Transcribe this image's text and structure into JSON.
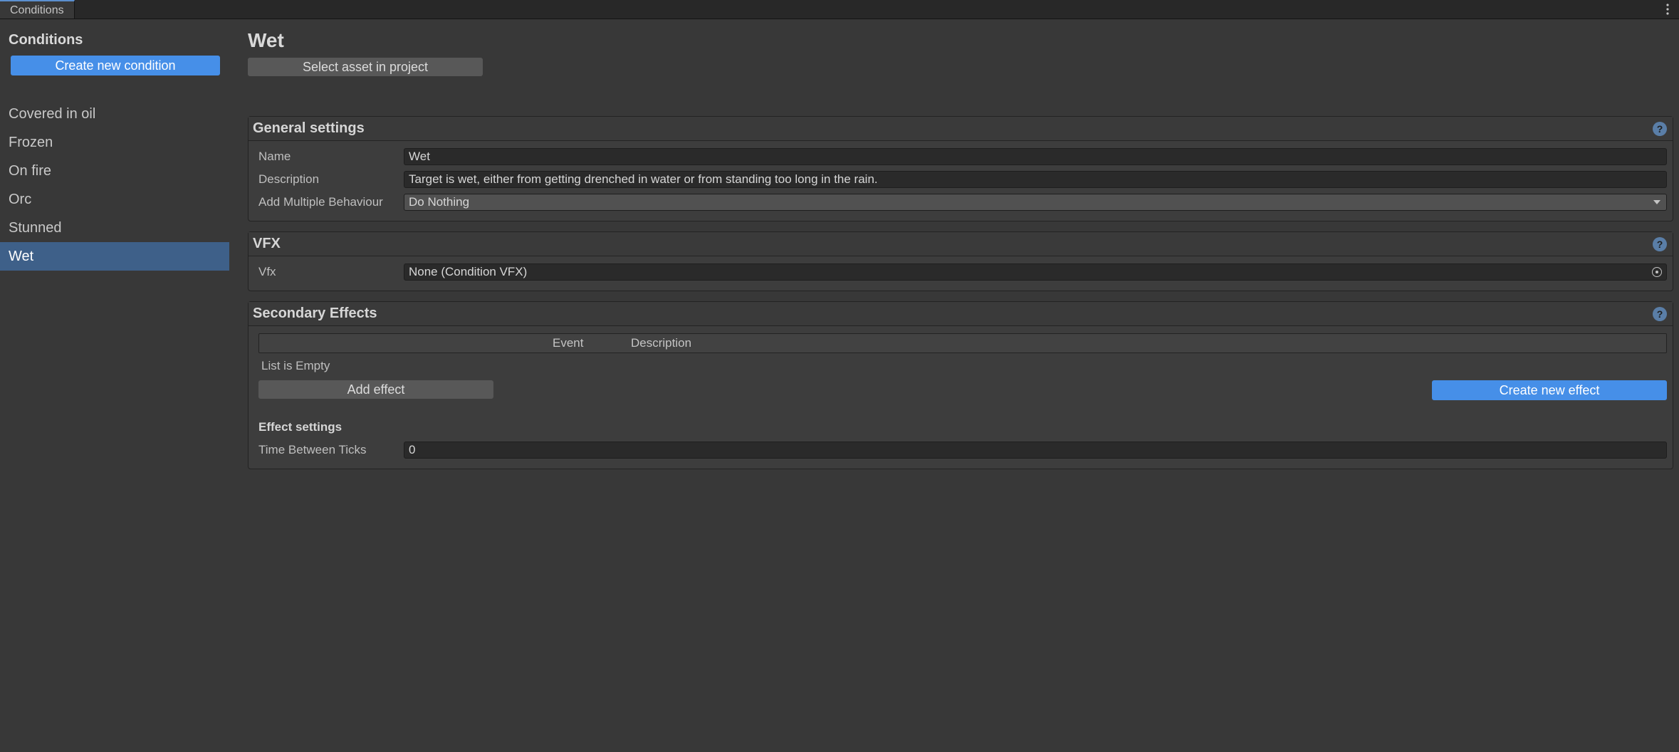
{
  "tabbar": {
    "tab_label": "Conditions"
  },
  "sidebar": {
    "title": "Conditions",
    "create_label": "Create new condition",
    "items": [
      {
        "label": "Covered in oil"
      },
      {
        "label": "Frozen"
      },
      {
        "label": "On fire"
      },
      {
        "label": "Orc"
      },
      {
        "label": "Stunned"
      },
      {
        "label": "Wet"
      }
    ],
    "selected_index": 5
  },
  "main": {
    "title": "Wet",
    "select_asset_label": "Select asset in project"
  },
  "general": {
    "header": "General settings",
    "labels": {
      "name": "Name",
      "description": "Description",
      "add_multiple": "Add Multiple Behaviour"
    },
    "values": {
      "name": "Wet",
      "description": "Target is wet, either from getting drenched in water or from standing too long in the rain.",
      "add_multiple": "Do Nothing"
    }
  },
  "vfx": {
    "header": "VFX",
    "label": "Vfx",
    "value": "None (Condition VFX)"
  },
  "secondary": {
    "header": "Secondary Effects",
    "columns": {
      "event": "Event",
      "description": "Description"
    },
    "empty_text": "List is Empty",
    "add_effect_label": "Add effect",
    "create_effect_label": "Create new effect",
    "effect_settings_header": "Effect settings",
    "time_between_ticks_label": "Time Between Ticks",
    "time_between_ticks_value": "0"
  },
  "help_glyph": "?"
}
